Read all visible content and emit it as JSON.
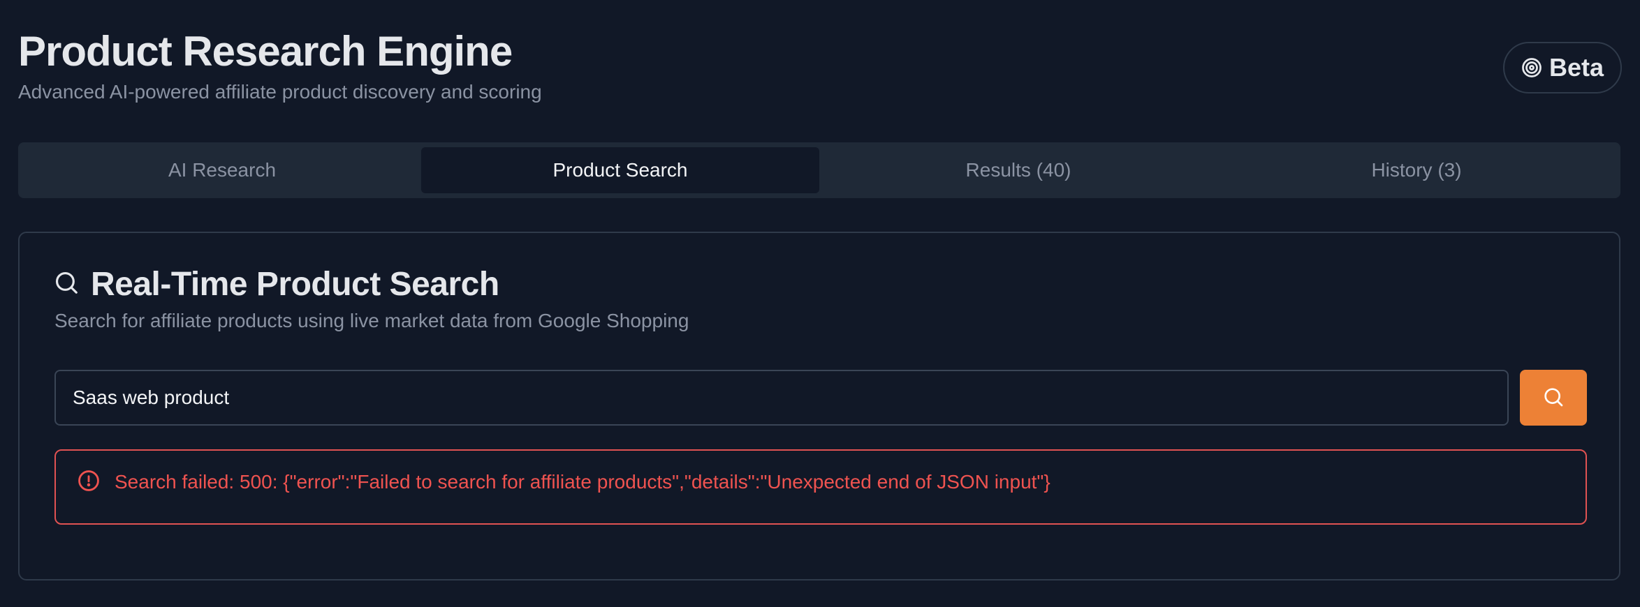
{
  "header": {
    "title": "Product Research Engine",
    "subtitle": "Advanced AI-powered affiliate product discovery and scoring",
    "badge": "Beta",
    "badge_icon": "target-icon"
  },
  "tabs": [
    {
      "label": "AI Research",
      "active": false
    },
    {
      "label": "Product Search",
      "active": true
    },
    {
      "label": "Results (40)",
      "active": false
    },
    {
      "label": "History (3)",
      "active": false
    }
  ],
  "search_card": {
    "icon": "search-icon",
    "title": "Real-Time Product Search",
    "description": "Search for affiliate products using live market data from Google Shopping",
    "input_value": "Saas web product",
    "button_icon": "search-icon"
  },
  "error": {
    "icon": "alert-circle-icon",
    "message": "Search failed: 500: {\"error\":\"Failed to search for affiliate products\",\"details\":\"Unexpected end of JSON input\"}"
  },
  "colors": {
    "background": "#111827",
    "tab_bar": "#1f2937",
    "accent": "#ed8136",
    "error": "#ef5350"
  }
}
